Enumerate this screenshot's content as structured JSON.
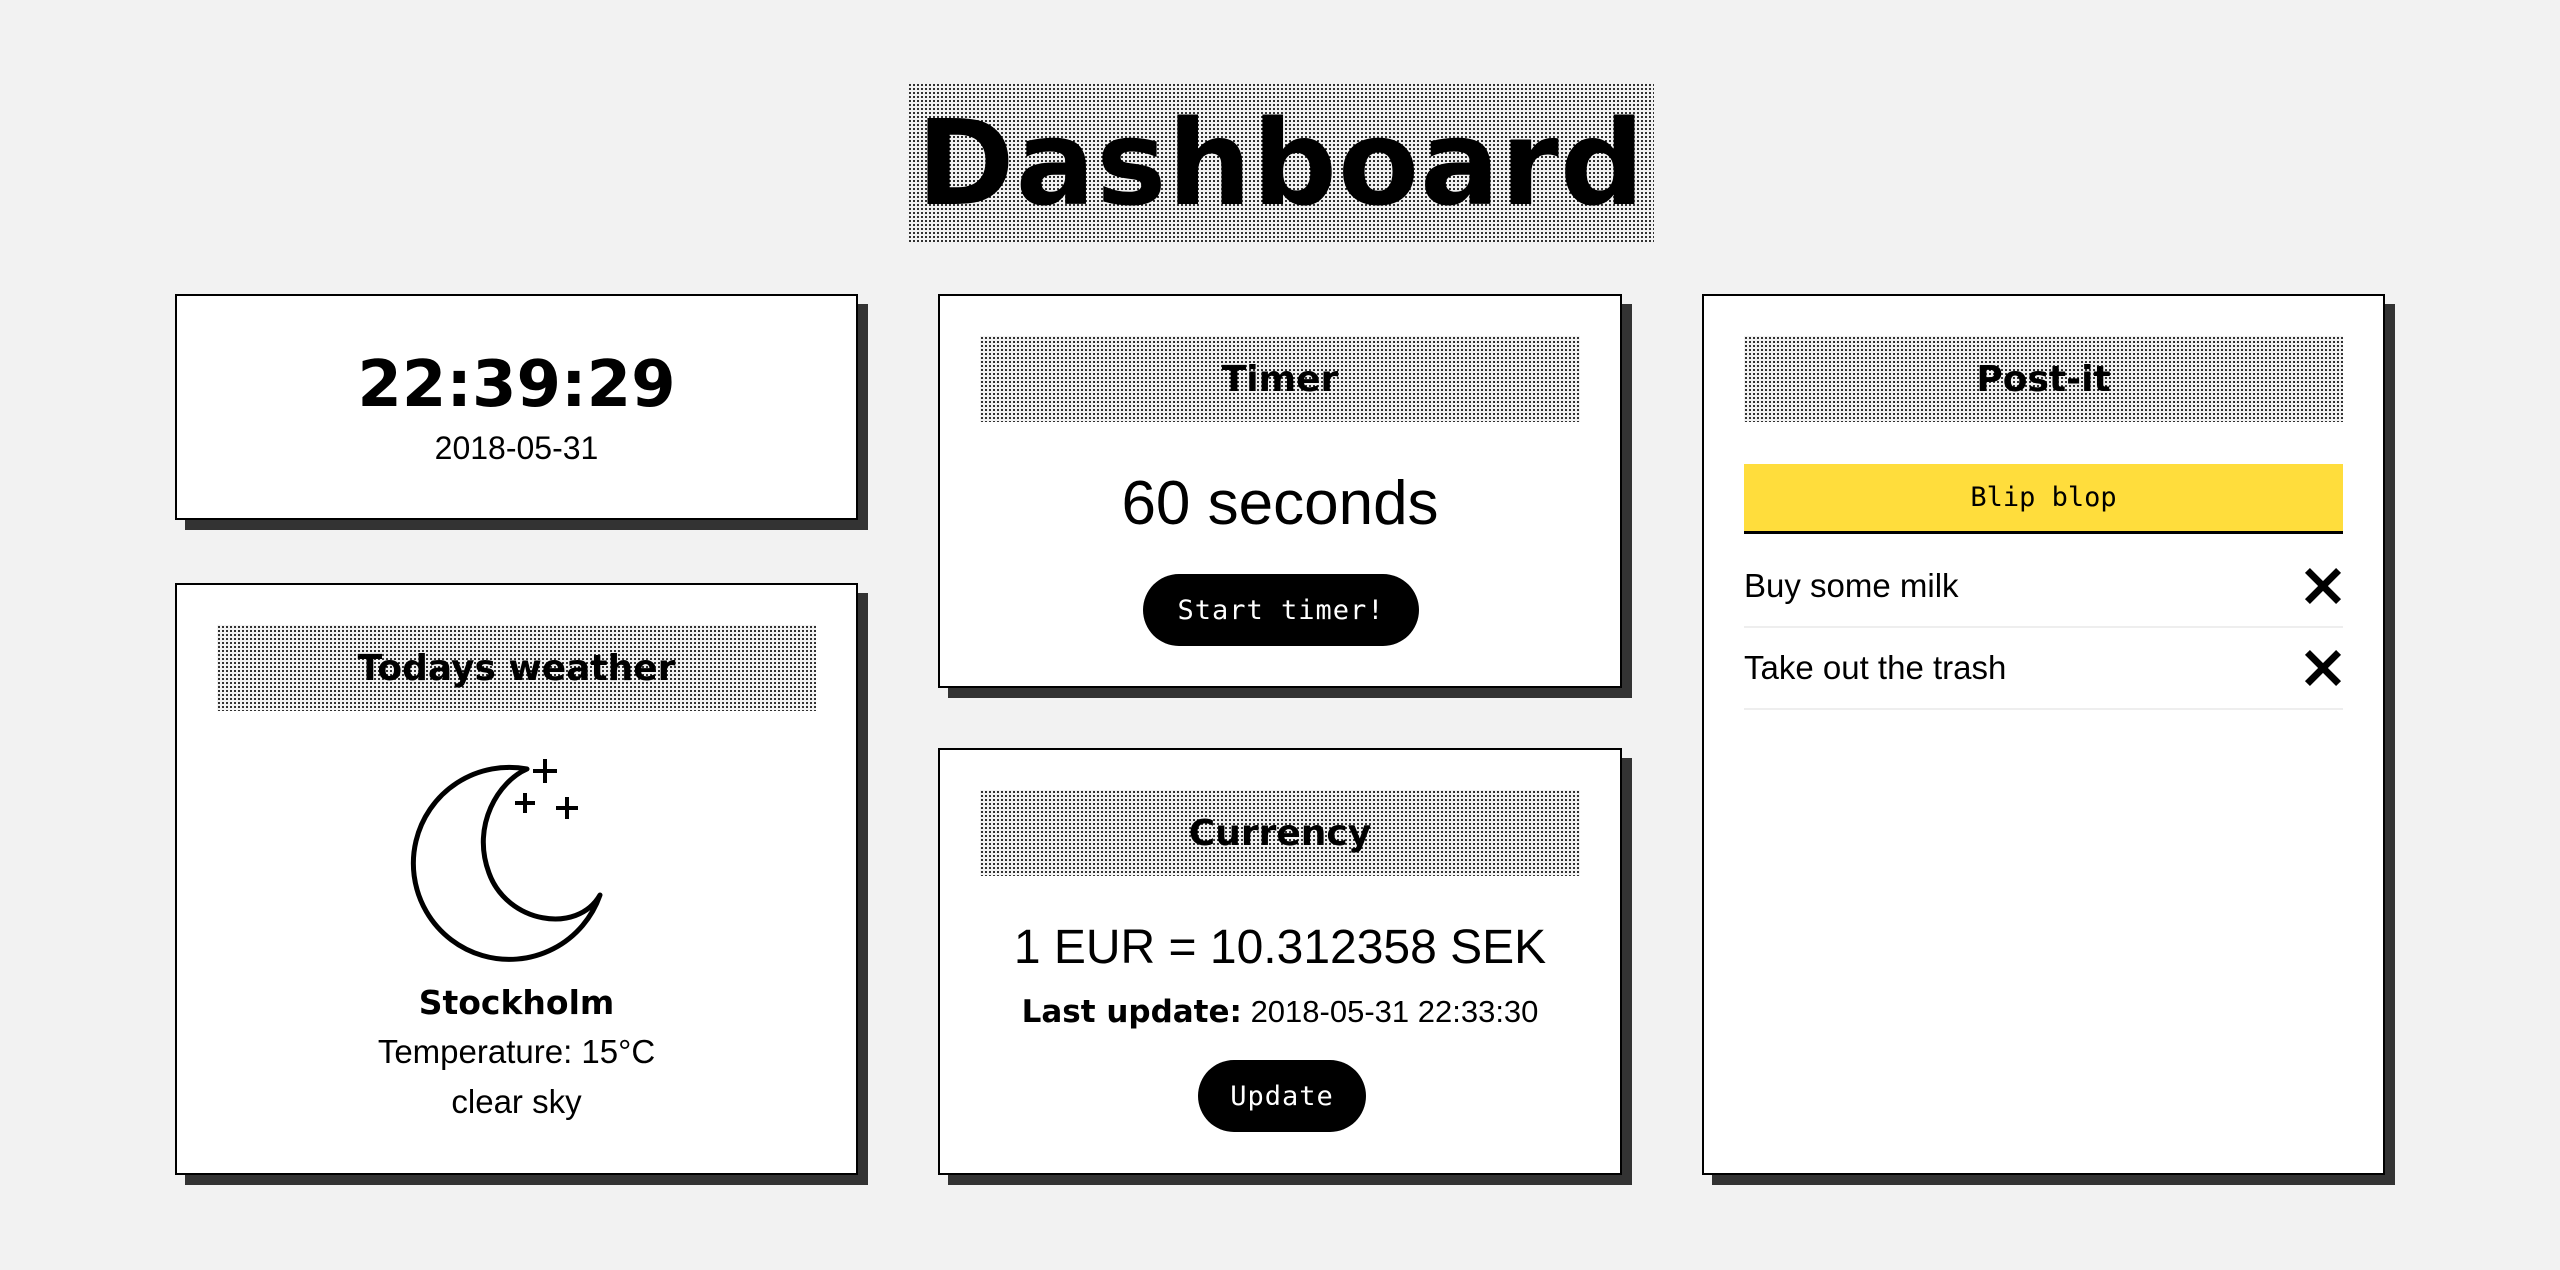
{
  "page": {
    "title": "Dashboard"
  },
  "clock": {
    "time": "22:39:29",
    "date": "2018-05-31"
  },
  "weather": {
    "header": "Todays weather",
    "icon": "moon-stars-icon",
    "city": "Stockholm",
    "temperature": "Temperature: 15°C",
    "description": "clear sky"
  },
  "timer": {
    "header": "Timer",
    "value": "60 seconds",
    "start_label": "Start timer!"
  },
  "currency": {
    "header": "Currency",
    "rate": "1 EUR = 10.312358 SEK",
    "last_update_label": "Last update:",
    "last_update_value": "2018-05-31 22:33:30",
    "update_label": "Update"
  },
  "postit": {
    "header": "Post-it",
    "input_value": "Blip blop",
    "items": [
      {
        "label": "Buy some milk"
      },
      {
        "label": "Take out the trash"
      }
    ]
  },
  "colors": {
    "background": "#f2f2f2",
    "postit_input": "#ffdd3c",
    "button": "#000000"
  }
}
